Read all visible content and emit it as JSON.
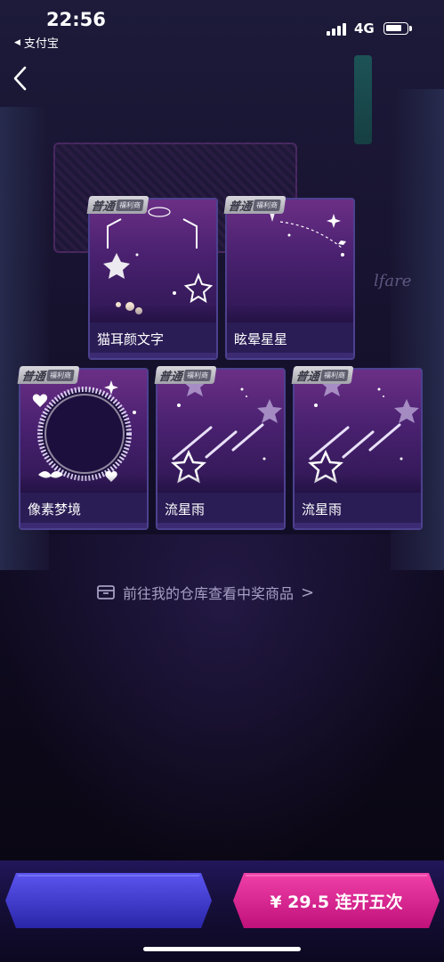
{
  "status_bar": {
    "time": "22:56",
    "back_app": "支付宝",
    "network": "4G",
    "battery_level": 0.8
  },
  "nav": {
    "back_icon": "chevron-left-icon"
  },
  "badge": {
    "main": "普通",
    "sub": "福利商"
  },
  "cards_row1": [
    {
      "name": "猫耳颜文字"
    },
    {
      "name": "眩晕星星"
    }
  ],
  "cards_row2": [
    {
      "name": "像素梦境"
    },
    {
      "name": "流星雨"
    },
    {
      "name": "流星雨"
    }
  ],
  "decor_text": "lfare",
  "warehouse_link": {
    "label": "前往我的仓库查看中奖商品",
    "icon": "box-icon",
    "chevron": ">"
  },
  "buttons": {
    "left_label": "",
    "right_label": "¥ 29.5 连开五次"
  },
  "colors": {
    "left_button": "#3a35c8",
    "right_button": "#e0208e",
    "card_bg": "#2a1c55"
  }
}
